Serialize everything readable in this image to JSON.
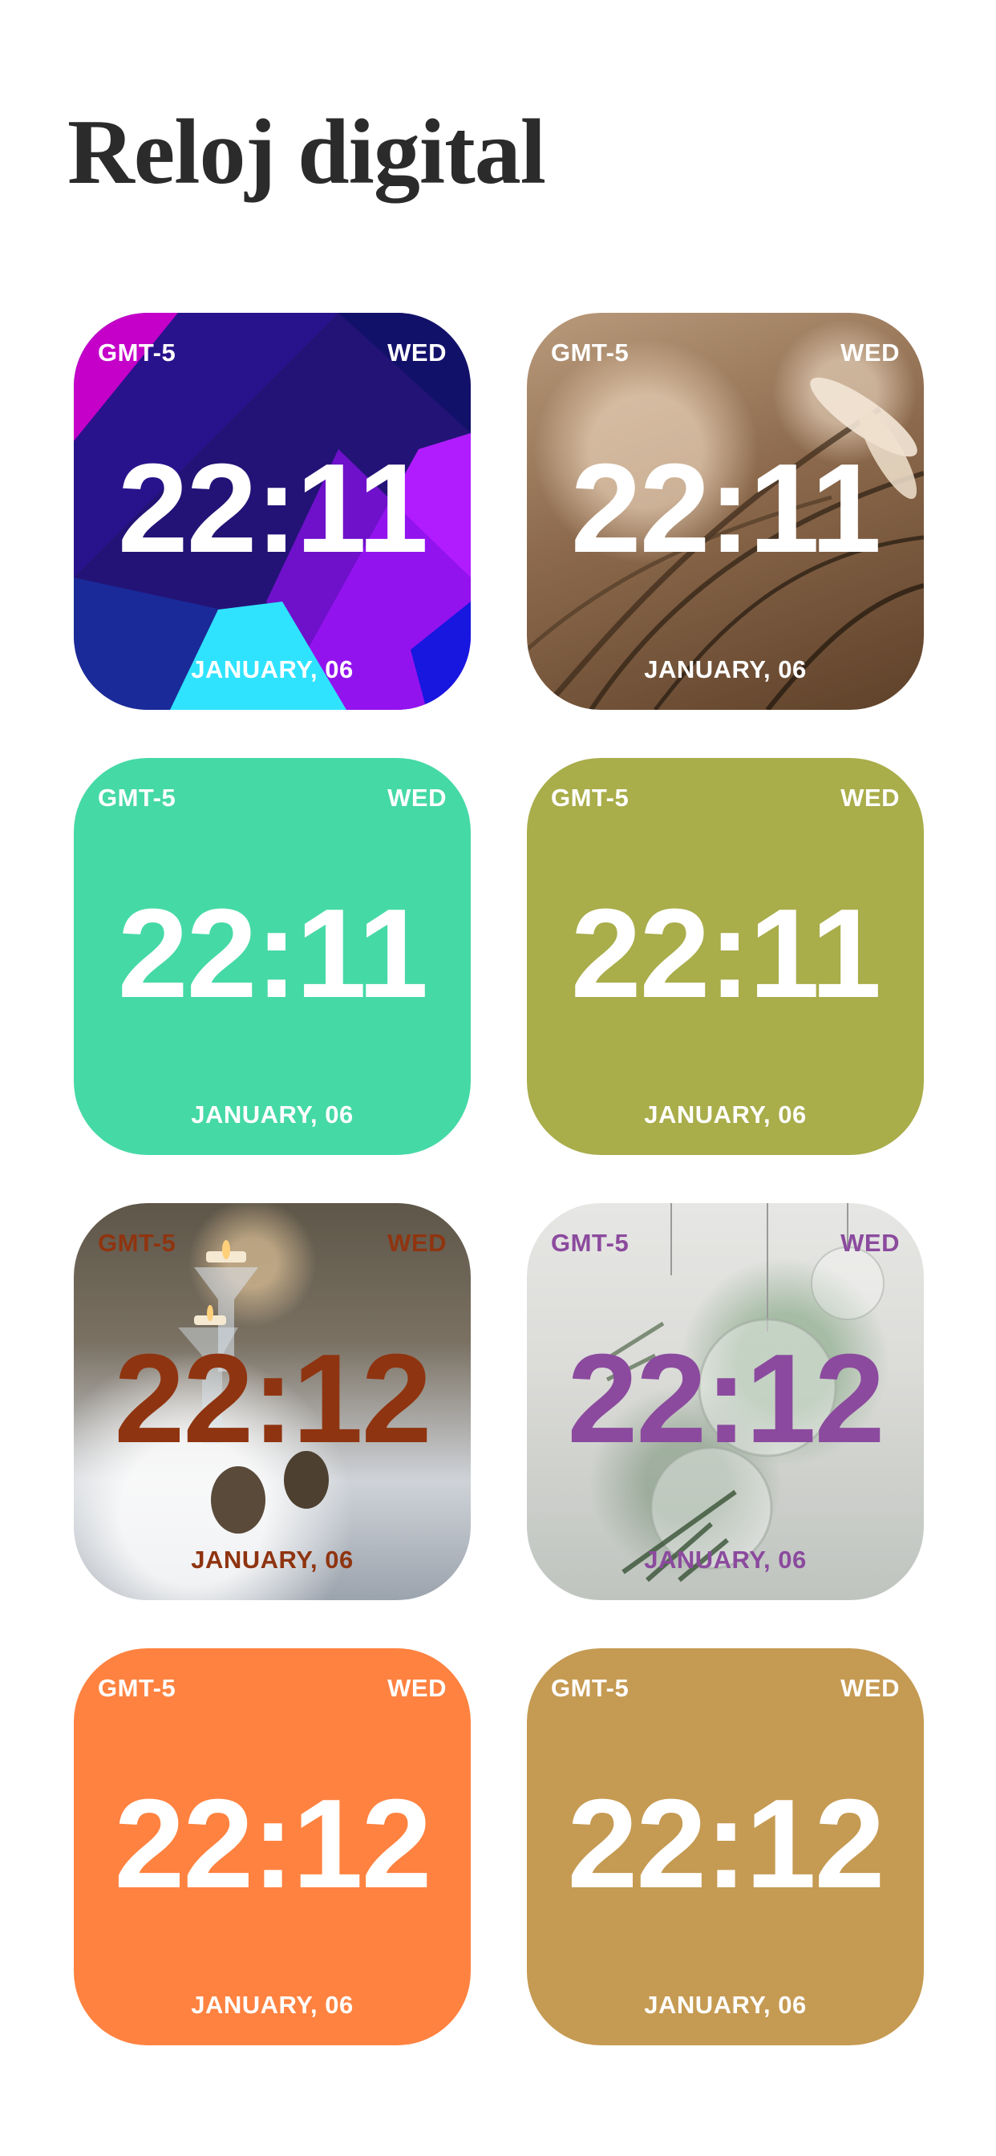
{
  "page": {
    "title": "Reloj digital"
  },
  "widgets": [
    {
      "background_type": "geometric",
      "background_colors": [
        "#231376",
        "#c400c9",
        "#b11cff",
        "#2fe3ff",
        "#1e2fb0",
        "#12116a"
      ],
      "text_color": "#ffffff",
      "timezone": "GMT-5",
      "day": "WED",
      "time": "22:11",
      "date": "JANUARY, 06"
    },
    {
      "background_type": "photo-grass",
      "text_color": "#ffffff",
      "timezone": "GMT-5",
      "day": "WED",
      "time": "22:11",
      "date": "JANUARY, 06"
    },
    {
      "background_type": "solid",
      "background_color": "#45d9a6",
      "text_color": "#ffffff",
      "timezone": "GMT-5",
      "day": "WED",
      "time": "22:11",
      "date": "JANUARY, 06"
    },
    {
      "background_type": "solid",
      "background_color": "#a9ad4a",
      "text_color": "#ffffff",
      "timezone": "GMT-5",
      "day": "WED",
      "time": "22:11",
      "date": "JANUARY, 06"
    },
    {
      "background_type": "photo-candles",
      "text_color": "#8f3410",
      "timezone": "GMT-5",
      "day": "WED",
      "time": "22:12",
      "date": "JANUARY, 06"
    },
    {
      "background_type": "photo-ornaments",
      "text_color": "#8b4a9e",
      "timezone": "GMT-5",
      "day": "WED",
      "time": "22:12",
      "date": "JANUARY, 06"
    },
    {
      "background_type": "solid",
      "background_color": "#ff8240",
      "text_color": "#ffffff",
      "timezone": "GMT-5",
      "day": "WED",
      "time": "22:12",
      "date": "JANUARY, 06"
    },
    {
      "background_type": "solid",
      "background_color": "#c59a52",
      "text_color": "#ffffff",
      "timezone": "GMT-5",
      "day": "WED",
      "time": "22:12",
      "date": "JANUARY, 06"
    }
  ]
}
